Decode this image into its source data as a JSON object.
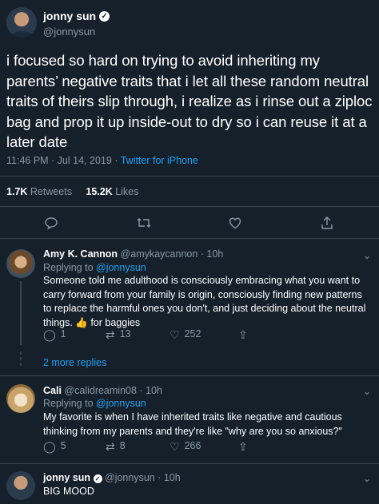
{
  "main": {
    "name": "jonny sun",
    "handle": "@jonnysun",
    "text": "i focused so hard on trying to avoid inheriting my parents’ negative traits that i let all these random neutral traits of theirs slip through, i realize as i rinse out a ziploc bag and prop it up inside-out to dry so i can reuse it at a later date",
    "time": "11:46 PM · Jul 14, 2019 · ",
    "source": "Twitter for iPhone",
    "retweets_count": "1.7K",
    "retweets_label": " Retweets",
    "likes_count": "15.2K",
    "likes_label": " Likes"
  },
  "replies": [
    {
      "name": "Amy K. Cannon",
      "handle": "@amykaycannon · 10h",
      "replying_to": "Replying to ",
      "replying_handle": "@jonnysun",
      "text": "Someone told me adulthood is consciously embracing what you want to carry forward from your family is origin, consciously finding new patterns to replace the harmful ones you don't, and just deciding about the neutral things. 👍 for baggies",
      "reply_count": "1",
      "retweet_count": "13",
      "like_count": "252"
    },
    {
      "name": "Cali",
      "handle": "@calidreamin08 · 10h",
      "replying_to": "Replying to ",
      "replying_handle": "@jonnysun",
      "text": "My favorite is when I have inherited traits like negative and cautious thinking from my parents and they're like \"why are you so anxious?\"",
      "reply_count": "5",
      "retweet_count": "8",
      "like_count": "266"
    },
    {
      "name": "jonny sun",
      "handle": "@jonnysun · 10h",
      "text": "BIG MOOD"
    }
  ],
  "more_replies": "2 more replies",
  "colors": {
    "background": "#15202b",
    "accent": "#1da1f2",
    "muted": "#8899a6",
    "divider": "#38444d"
  }
}
